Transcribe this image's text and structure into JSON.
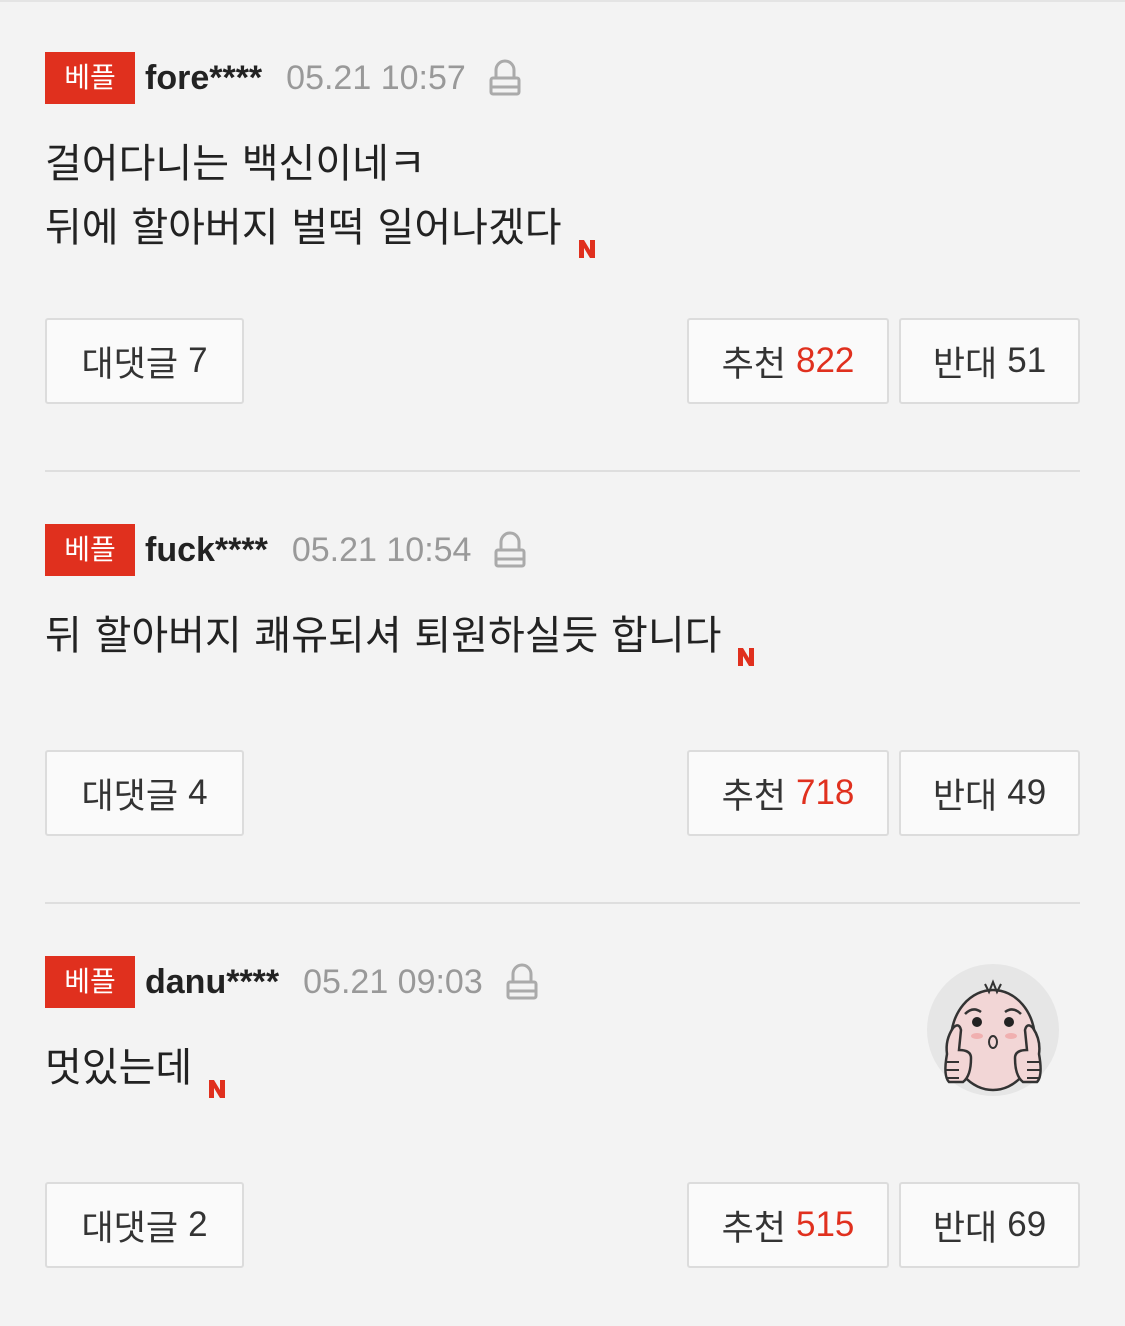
{
  "colors": {
    "accent": "#e0301e",
    "background": "#f3f3f3",
    "muted": "#999999"
  },
  "comments": [
    {
      "badge": "베플",
      "user": "fore****",
      "time": "05.21 10:57",
      "lines": [
        "걸어다니는 백신이네ㅋ",
        "뒤에 할아버지 벌떡 일어나겠다"
      ],
      "reply_label": "대댓글",
      "reply_count": "7",
      "like_label": "추천",
      "like_count": "822",
      "dislike_label": "반대",
      "dislike_count": "51"
    },
    {
      "badge": "베플",
      "user": "fuck****",
      "time": "05.21 10:54",
      "lines": [
        "뒤 할아버지 쾌유되셔 퇴원하실듯 합니다"
      ],
      "reply_label": "대댓글",
      "reply_count": "4",
      "like_label": "추천",
      "like_count": "718",
      "dislike_label": "반대",
      "dislike_count": "49"
    },
    {
      "badge": "베플",
      "user": "danu****",
      "time": "05.21 09:03",
      "lines": [
        "멋있는데"
      ],
      "reply_label": "대댓글",
      "reply_count": "2",
      "like_label": "추천",
      "like_count": "515",
      "dislike_label": "반대",
      "dislike_count": "69",
      "emoticon": "thumbs-up-character"
    }
  ],
  "icons": {
    "lock": "lock-icon",
    "new": "new-n-icon"
  }
}
